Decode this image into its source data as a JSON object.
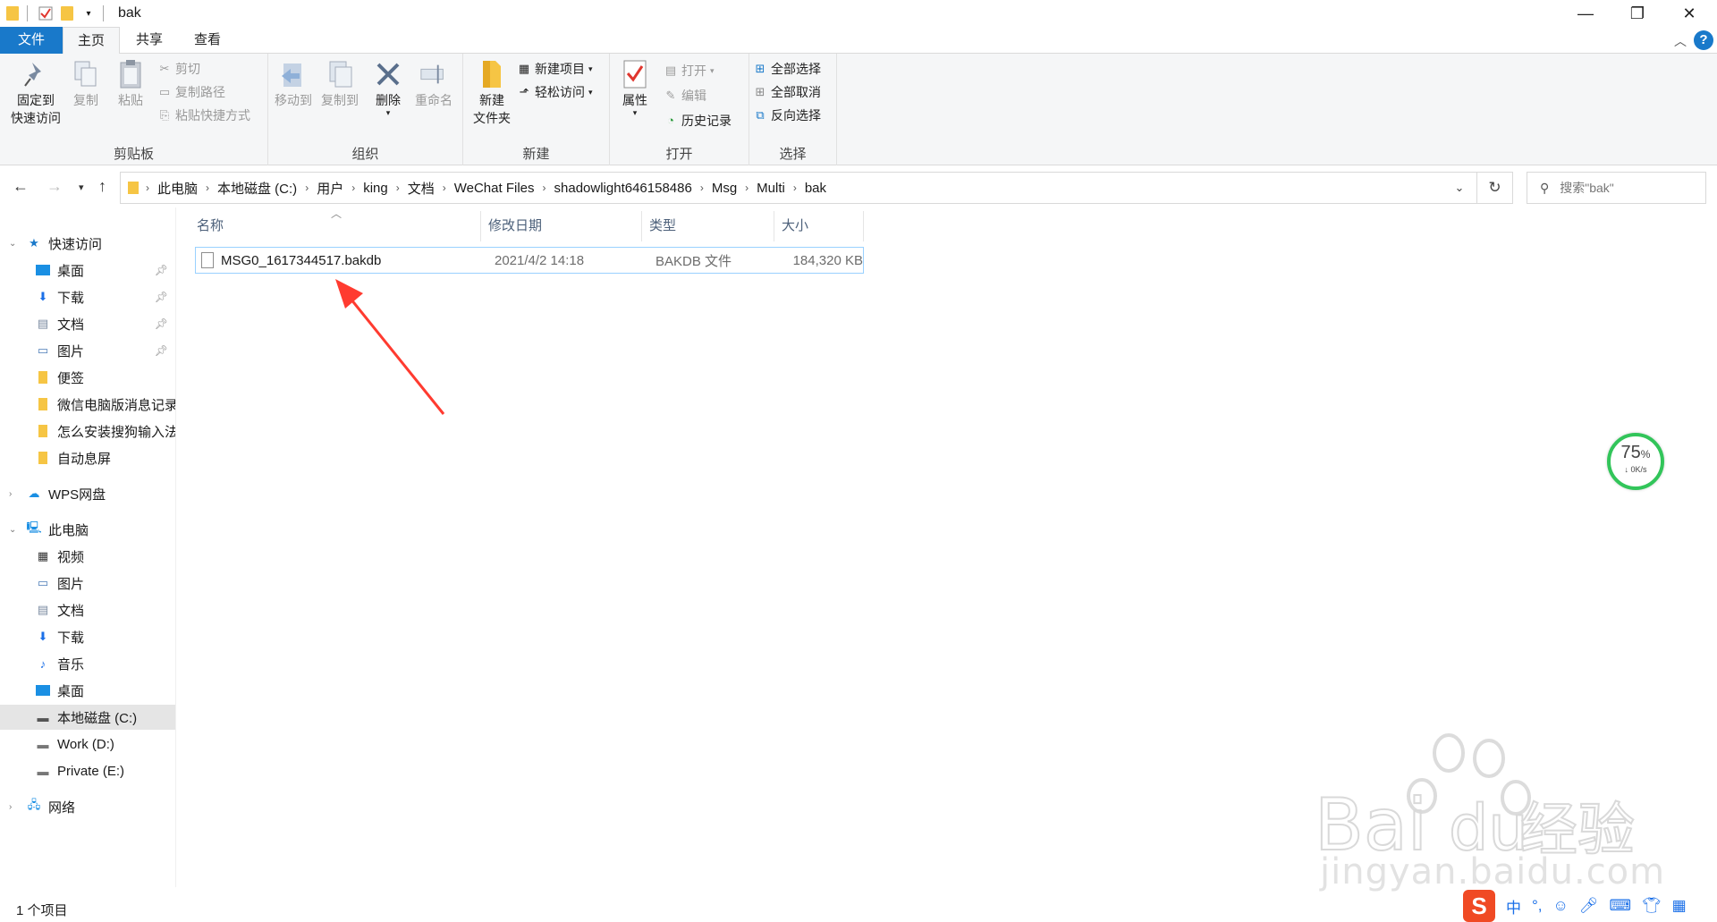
{
  "window": {
    "title": "bak",
    "minimize_glyph": "—",
    "restore_glyph": "❐",
    "close_glyph": "✕"
  },
  "ribbon_tabs": [
    {
      "label": "文件"
    },
    {
      "label": "主页"
    },
    {
      "label": "共享"
    },
    {
      "label": "查看"
    }
  ],
  "help_label": "?",
  "ribbon": {
    "clipboard": {
      "label": "剪贴板",
      "pin_line1": "固定到",
      "pin_line2": "快速访问",
      "copy": "复制",
      "paste": "粘贴",
      "cut": "剪切",
      "copy_path": "复制路径",
      "paste_shortcut": "粘贴快捷方式"
    },
    "organize": {
      "label": "组织",
      "move_to": "移动到",
      "copy_to": "复制到",
      "delete": "删除",
      "rename": "重命名"
    },
    "new": {
      "label": "新建",
      "new_folder_line1": "新建",
      "new_folder_line2": "文件夹",
      "new_item": "新建项目",
      "easy_access": "轻松访问"
    },
    "open": {
      "label": "打开",
      "properties": "属性",
      "open": "打开",
      "edit": "编辑",
      "history": "历史记录"
    },
    "select": {
      "label": "选择",
      "select_all": "全部选择",
      "select_none": "全部取消",
      "invert": "反向选择"
    }
  },
  "breadcrumb": [
    "此电脑",
    "本地磁盘 (C:)",
    "用户",
    "king",
    "文档",
    "WeChat Files",
    "shadowlight646158486",
    "Msg",
    "Multi",
    "bak"
  ],
  "search": {
    "placeholder": "搜索\"bak\""
  },
  "sidebar": {
    "quick_access": {
      "label": "快速访问"
    },
    "quick_items": [
      {
        "label": "桌面",
        "icon": "desktop-icon",
        "pinned": true
      },
      {
        "label": "下载",
        "icon": "download-icon",
        "pinned": true
      },
      {
        "label": "文档",
        "icon": "document-icon",
        "pinned": true
      },
      {
        "label": "图片",
        "icon": "picture-icon",
        "pinned": true
      },
      {
        "label": "便签",
        "icon": "folder-icon",
        "pinned": false
      },
      {
        "label": "微信电脑版消息记录",
        "icon": "folder-icon",
        "pinned": false
      },
      {
        "label": "怎么安装搜狗输入法",
        "icon": "folder-icon",
        "pinned": false
      },
      {
        "label": "自动息屏",
        "icon": "folder-icon",
        "pinned": false
      }
    ],
    "wps": {
      "label": "WPS网盘"
    },
    "this_pc": {
      "label": "此电脑"
    },
    "pc_items": [
      {
        "label": "视频",
        "icon": "video-icon"
      },
      {
        "label": "图片",
        "icon": "picture-icon"
      },
      {
        "label": "文档",
        "icon": "document-icon"
      },
      {
        "label": "下载",
        "icon": "download-icon"
      },
      {
        "label": "音乐",
        "icon": "music-icon"
      },
      {
        "label": "桌面",
        "icon": "desktop-icon"
      },
      {
        "label": "本地磁盘 (C:)",
        "icon": "drive-c-icon"
      },
      {
        "label": "Work (D:)",
        "icon": "drive-icon"
      },
      {
        "label": "Private (E:)",
        "icon": "drive-icon"
      }
    ],
    "network": {
      "label": "网络"
    }
  },
  "columns": [
    "名称",
    "修改日期",
    "类型",
    "大小"
  ],
  "files": [
    {
      "name": "MSG0_1617344517.bakdb",
      "modified": "2021/4/2 14:18",
      "type": "BAKDB 文件",
      "size": "184,320 KB"
    }
  ],
  "speed_widget": {
    "percent": "75",
    "percent_sign": "%",
    "rate": "↓ 0K/s"
  },
  "status": {
    "count": "1 个项目"
  },
  "watermark": {
    "text": "jingyan.baidu.com",
    "brand": "Bai",
    "brand2": "du",
    "brand3": "经验"
  },
  "ime": {
    "logo": "S",
    "mode": "中",
    "punct": "°,"
  },
  "colors": {
    "accent": "#1979ca",
    "selection_border": "#99d1ff",
    "arrow_red": "#ff3b30",
    "speed_green": "#32c55a"
  }
}
